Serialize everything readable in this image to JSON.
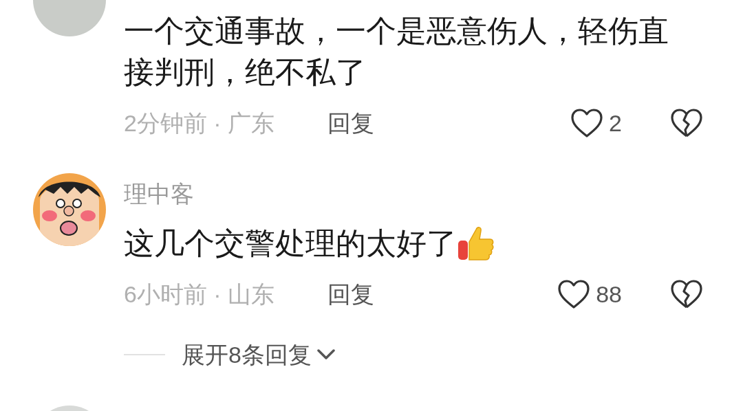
{
  "comments": [
    {
      "avatar": {
        "kind": "photo"
      },
      "text": "一个交通事故，一个是恶意伤人，轻伤直接判刑，绝不私了",
      "time": "2分钟前 · 广东",
      "reply": "回复",
      "likes": "2"
    },
    {
      "avatar": {
        "kind": "cartoon"
      },
      "author": "理中客",
      "text": "这几个交警处理的太好了",
      "emoji": {
        "kind": "thumbs_up"
      },
      "time": "6小时前 · 山东",
      "reply": "回复",
      "likes": "88",
      "replies_toggle": "展开8条回复"
    },
    {
      "avatar": {
        "kind": "photo"
      }
    }
  ]
}
